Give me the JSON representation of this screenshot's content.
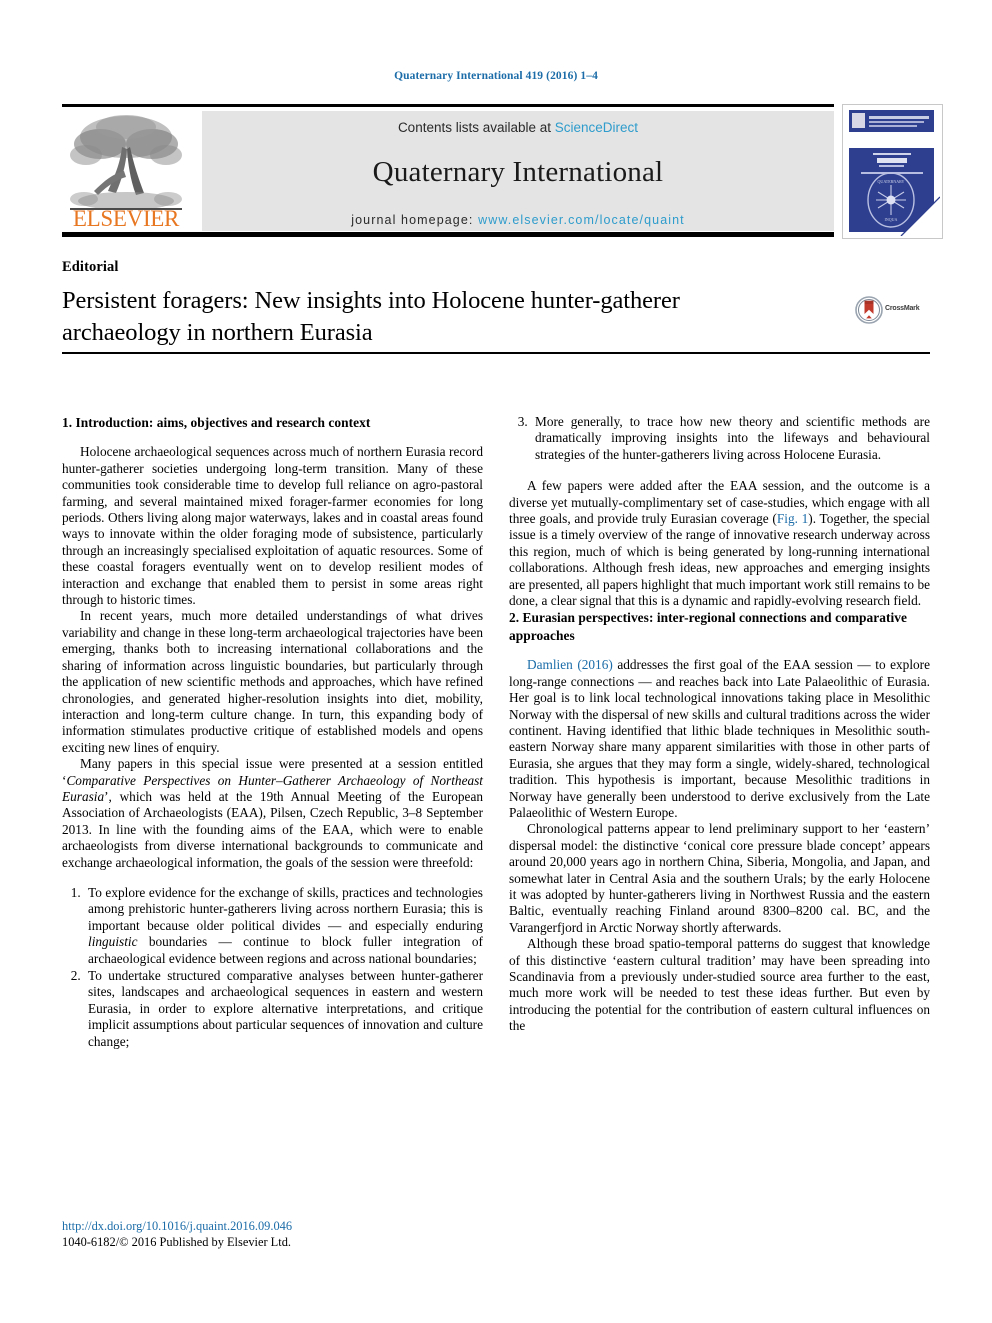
{
  "running_head": "Quaternary International 419 (2016) 1–4",
  "masthead": {
    "contents_text": "Contents lists available at ",
    "contents_link": "ScienceDirect",
    "journal_name": "Quaternary International",
    "homepage_label": "journal homepage: ",
    "homepage_url": "www.elsevier.com/locate/quaint",
    "publisher_logo_text": "ELSEVIER",
    "cover_thumb_name": "journal-cover-thumbnail"
  },
  "article": {
    "type": "Editorial",
    "title": "Persistent foragers: New insights into Holocene hunter-gatherer archaeology in northern Eurasia",
    "crossmark_label": "CrossMark"
  },
  "left_column": {
    "section_heading": "1. Introduction: aims, objectives and research context",
    "paragraphs": [
      "Holocene archaeological sequences across much of northern Eurasia record hunter-gatherer societies undergoing long-term transition. Many of these communities took considerable time to develop full reliance on agro-pastoral farming, and several maintained mixed forager-farmer economies for long periods. Others living along major waterways, lakes and in coastal areas found ways to innovate within the older foraging mode of subsistence, particularly through an increasingly specialised exploitation of aquatic resources. Some of these coastal foragers eventually went on to develop resilient modes of interaction and exchange that enabled them to persist in some areas right through to historic times.",
      "In recent years, much more detailed understandings of what drives variability and change in these long-term archaeological trajectories have been emerging, thanks both to increasing international collaborations and the sharing of information across linguistic boundaries, but particularly through the application of new scientific methods and approaches, which have refined chronologies, and generated higher-resolution insights into diet, mobility, interaction and long-term culture change. In turn, this expanding body of information stimulates productive critique of established models and opens exciting new lines of enquiry."
    ],
    "eaa_paragraph": {
      "before_italic": "Many papers in this special issue were presented at a session entitled ‘",
      "italic": "Comparative Perspectives on Hunter–Gatherer Archaeology of Northeast Eurasia",
      "after_italic": "’, which was held at the 19th Annual Meeting of the European Association of Archaeologists (EAA), Pilsen, Czech Republic, 3–8 September 2013. In line with the founding aims of the EAA, which were to enable archaeologists from diverse international backgrounds to communicate and exchange archaeological information, the goals of the session were threefold:"
    },
    "goals": [
      {
        "before_italic": "To explore evidence for the exchange of skills, practices and technologies among prehistoric hunter-gatherers living across northern Eurasia; this is important because older political divides — and especially enduring ",
        "italic": "linguistic",
        "after_italic": " boundaries — continue to block fuller integration of archaeological evidence between regions and across national boundaries;"
      },
      {
        "before_italic": "To undertake structured comparative analyses between hunter-gatherer sites, landscapes and archaeological sequences in eastern and western Eurasia, in order to explore alternative interpretations, and critique implicit assumptions about particular sequences of innovation and culture change;",
        "italic": "",
        "after_italic": ""
      }
    ]
  },
  "right_column": {
    "goal_three": "More generally, to trace how new theory and scientific methods are dramatically improving insights into the lifeways and behavioural strategies of the hunter-gatherers living across Holocene Eurasia.",
    "fig_paragraph": {
      "before_link": "A few papers were added after the EAA session, and the outcome is a diverse yet mutually-complimentary set of case-studies, which engage with all three goals, and provide truly Eurasian coverage (",
      "link": "Fig. 1",
      "after_link": "). Together, the special issue is a timely overview of the range of innovative research underway across this region, much of which is being generated by long-running international collaborations. Although fresh ideas, new approaches and emerging insights are presented, all papers highlight that much important work still remains to be done, a clear signal that this is a dynamic and rapidly-evolving research field."
    },
    "section_heading": "2. Eurasian perspectives: inter-regional connections and comparative approaches",
    "damlien_paragraph": {
      "citation": "Damlien (2016)",
      "rest": " addresses the first goal of the EAA session — to explore long-range connections — and reaches back into Late Palaeolithic of Eurasia. Her goal is to link local technological innovations taking place in Mesolithic Norway with the dispersal of new skills and cultural traditions across the wider continent. Having identified that lithic blade techniques in Mesolithic south-eastern Norway share many apparent similarities with those in other parts of Eurasia, she argues that they may form a single, widely-shared, technological tradition. This hypothesis is important, because Mesolithic traditions in Norway have generally been understood to derive exclusively from the Late Palaeolithic of Western Europe."
    },
    "paragraphs": [
      "Chronological patterns appear to lend preliminary support to her ‘eastern’ dispersal model: the distinctive ‘conical core pressure blade concept’ appears around 20,000 years ago in northern China, Siberia, Mongolia, and Japan, and somewhat later in Central Asia and the southern Urals; by the early Holocene it was adopted by hunter-gatherers living in Northwest Russia and the eastern Baltic, eventually reaching Finland around 8300–8200 cal. BC, and the Varangerfjord in Arctic Norway shortly afterwards.",
      "Although these broad spatio-temporal patterns do suggest that knowledge of this distinctive ‘eastern cultural tradition’ may have been spreading into Scandinavia from a previously under-studied source area further to the east, much more work will be needed to test these ideas further. But even by introducing the potential for the contribution of eastern cultural influences on the"
    ]
  },
  "footer": {
    "doi": "http://dx.doi.org/10.1016/j.quaint.2016.09.046",
    "copyright": "1040-6182/© 2016 Published by Elsevier Ltd."
  },
  "colors": {
    "link_blue": "#1b6ca8",
    "sciencedirect_blue": "#2e9ccc",
    "elsevier_orange": "#e87722",
    "band_gray": "#e4e4e4",
    "cover_blue": "#2e3f8f"
  }
}
